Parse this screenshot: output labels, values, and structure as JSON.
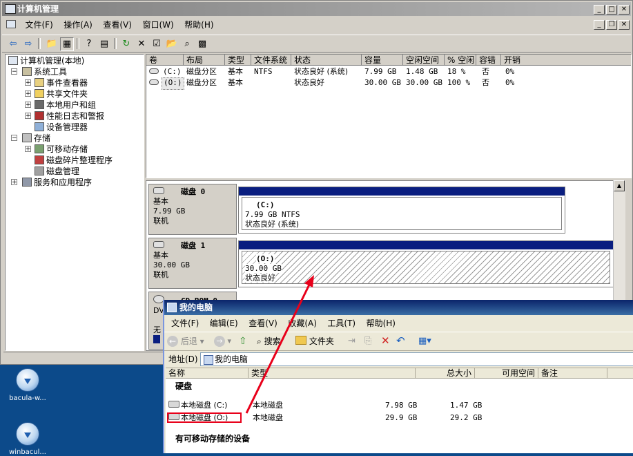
{
  "desktop": {
    "icons": [
      {
        "label": "bacula-w...",
        "icon": "installer-icon"
      },
      {
        "label": "winbacul...",
        "icon": "installer-icon"
      }
    ]
  },
  "main_window": {
    "title": "计算机管理",
    "menu": [
      "文件(F)",
      "操作(A)",
      "查看(V)",
      "窗口(W)",
      "帮助(H)"
    ],
    "tree": [
      {
        "label": "计算机管理(本地)",
        "level": 0,
        "expander": ""
      },
      {
        "label": "系统工具",
        "level": 1,
        "expander": "−"
      },
      {
        "label": "事件查看器",
        "level": 2,
        "expander": "+"
      },
      {
        "label": "共享文件夹",
        "level": 2,
        "expander": "+"
      },
      {
        "label": "本地用户和组",
        "level": 2,
        "expander": "+"
      },
      {
        "label": "性能日志和警报",
        "level": 2,
        "expander": "+"
      },
      {
        "label": "设备管理器",
        "level": 2,
        "expander": ""
      },
      {
        "label": "存储",
        "level": 1,
        "expander": "−"
      },
      {
        "label": "可移动存储",
        "level": 2,
        "expander": "+"
      },
      {
        "label": "磁盘碎片整理程序",
        "level": 2,
        "expander": ""
      },
      {
        "label": "磁盘管理",
        "level": 2,
        "expander": ""
      },
      {
        "label": "服务和应用程序",
        "level": 1,
        "expander": "+"
      }
    ],
    "volume_table": {
      "headers": [
        "卷",
        "布局",
        "类型",
        "文件系统",
        "状态",
        "容量",
        "空闲空间",
        "% 空闲",
        "容错",
        "开销"
      ],
      "rows": [
        [
          "(C:)",
          "磁盘分区",
          "基本",
          "NTFS",
          "状态良好 (系统)",
          "7.99 GB",
          "1.48 GB",
          "18 %",
          "否",
          "0%"
        ],
        [
          "(O:)",
          "磁盘分区",
          "基本",
          "",
          "状态良好",
          "30.00 GB",
          "30.00 GB",
          "100 %",
          "否",
          "0%"
        ]
      ]
    },
    "disks": [
      {
        "name": "磁盘 0",
        "type": "基本",
        "size": "7.99 GB",
        "status": "联机",
        "volume": {
          "name": "(C:)",
          "detail": "7.99 GB NTFS",
          "state": "状态良好 (系统)"
        }
      },
      {
        "name": "磁盘 1",
        "type": "基本",
        "size": "30.00 GB",
        "status": "联机",
        "volume": {
          "name": "(O:)",
          "detail": "30.00 GB",
          "state": "状态良好"
        }
      },
      {
        "name": "CD-ROM 0",
        "type": "DV",
        "size": "",
        "status": "无"
      }
    ]
  },
  "explorer": {
    "title": "我的电脑",
    "menu": [
      "文件(F)",
      "编辑(E)",
      "查看(V)",
      "收藏(A)",
      "工具(T)",
      "帮助(H)"
    ],
    "toolbar": {
      "back": "后退",
      "search": "搜索",
      "folders": "文件夹"
    },
    "address_label": "地址(D)",
    "address_value": "我的电脑",
    "columns": [
      "名称",
      "类型",
      "总大小",
      "可用空间",
      "备注"
    ],
    "group_hard_disks": "硬盘",
    "drives": [
      {
        "name": "本地磁盘 (C:)",
        "type": "本地磁盘",
        "total": "7.98 GB",
        "free": "1.47 GB"
      },
      {
        "name": "本地磁盘 (O:)",
        "type": "本地磁盘",
        "total": "29.9 GB",
        "free": "29.2 GB"
      }
    ],
    "group_removable": "有可移动存储的设备"
  },
  "colors": {
    "annotation": "#e8001a",
    "volume_bar": "#0a1e80"
  }
}
